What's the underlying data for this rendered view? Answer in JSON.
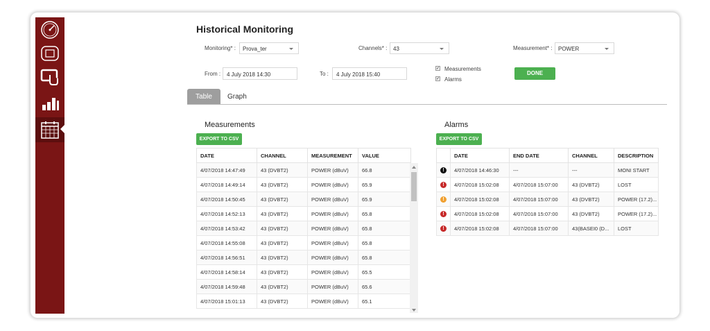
{
  "sidebar": {
    "items": [
      {
        "icon": "gauge-icon"
      },
      {
        "icon": "monitor-icon"
      },
      {
        "icon": "touch-screen-icon"
      },
      {
        "icon": "bar-chart-icon"
      },
      {
        "icon": "calendar-icon"
      }
    ],
    "active_index": 4
  },
  "page_title": "Historical Monitoring",
  "filters": {
    "monitoring_label": "Monitoring* :",
    "monitoring_value": "Prova_ter",
    "channels_label": "Channels* :",
    "channels_value": "43",
    "measurement_label": "Measurement* :",
    "measurement_value": "POWER",
    "from_label": "From :",
    "from_value": "4 July 2018 14:30",
    "to_label": "To :",
    "to_value": "4 July 2018 15:40",
    "measurements_checkbox": "Measurements",
    "alarms_checkbox": "Alarms",
    "done_label": "DONE"
  },
  "tabs": [
    {
      "label": "Table",
      "active": true
    },
    {
      "label": "Graph",
      "active": false
    }
  ],
  "measurements": {
    "title": "Measurements",
    "export_label": "EXPORT TO CSV",
    "columns": [
      "DATE",
      "CHANNEL",
      "MEASUREMENT",
      "VALUE"
    ],
    "rows": [
      [
        "4/07/2018 14:47:49",
        "43 (DVBT2)",
        "POWER (dBuV)",
        "66.8"
      ],
      [
        "4/07/2018 14:49:14",
        "43 (DVBT2)",
        "POWER (dBuV)",
        "65.9"
      ],
      [
        "4/07/2018 14:50:45",
        "43 (DVBT2)",
        "POWER (dBuV)",
        "65.9"
      ],
      [
        "4/07/2018 14:52:13",
        "43 (DVBT2)",
        "POWER (dBuV)",
        "65.8"
      ],
      [
        "4/07/2018 14:53:42",
        "43 (DVBT2)",
        "POWER (dBuV)",
        "65.8"
      ],
      [
        "4/07/2018 14:55:08",
        "43 (DVBT2)",
        "POWER (dBuV)",
        "65.8"
      ],
      [
        "4/07/2018 14:56:51",
        "43 (DVBT2)",
        "POWER (dBuV)",
        "65.8"
      ],
      [
        "4/07/2018 14:58:14",
        "43 (DVBT2)",
        "POWER (dBuV)",
        "65.5"
      ],
      [
        "4/07/2018 14:59:48",
        "43 (DVBT2)",
        "POWER (dBuV)",
        "65.6"
      ],
      [
        "4/07/2018 15:01:13",
        "43 (DVBT2)",
        "POWER (dBuV)",
        "65.1"
      ]
    ]
  },
  "alarms": {
    "title": "Alarms",
    "export_label": "EXPORT TO CSV",
    "columns": [
      "",
      "DATE",
      "END DATE",
      "CHANNEL",
      "DESCRIPTION"
    ],
    "rows": [
      {
        "severity": "info",
        "color": "#111111",
        "cells": [
          "4/07/2018 14:46:30",
          "---",
          "---",
          "MONI START"
        ]
      },
      {
        "severity": "error",
        "color": "#c62828",
        "cells": [
          "4/07/2018 15:02:08",
          "4/07/2018 15:07:00",
          "43 (DVBT2)",
          "LOST"
        ]
      },
      {
        "severity": "warning",
        "color": "#f0a030",
        "cells": [
          "4/07/2018 15:02:08",
          "4/07/2018 15:07:00",
          "43 (DVBT2)",
          "POWER (17.2)..."
        ]
      },
      {
        "severity": "error",
        "color": "#c62828",
        "cells": [
          "4/07/2018 15:02:08",
          "4/07/2018 15:07:00",
          "43 (DVBT2)",
          "POWER (17.2)..."
        ]
      },
      {
        "severity": "error",
        "color": "#c62828",
        "cells": [
          "4/07/2018 15:02:08",
          "4/07/2018 15:07:00",
          "43(BASEI0 (D...",
          "LOST"
        ]
      }
    ]
  },
  "colors": {
    "sidebar": "#7a1515",
    "accent_green": "#4cb050",
    "tab_active": "#9e9e9e"
  }
}
